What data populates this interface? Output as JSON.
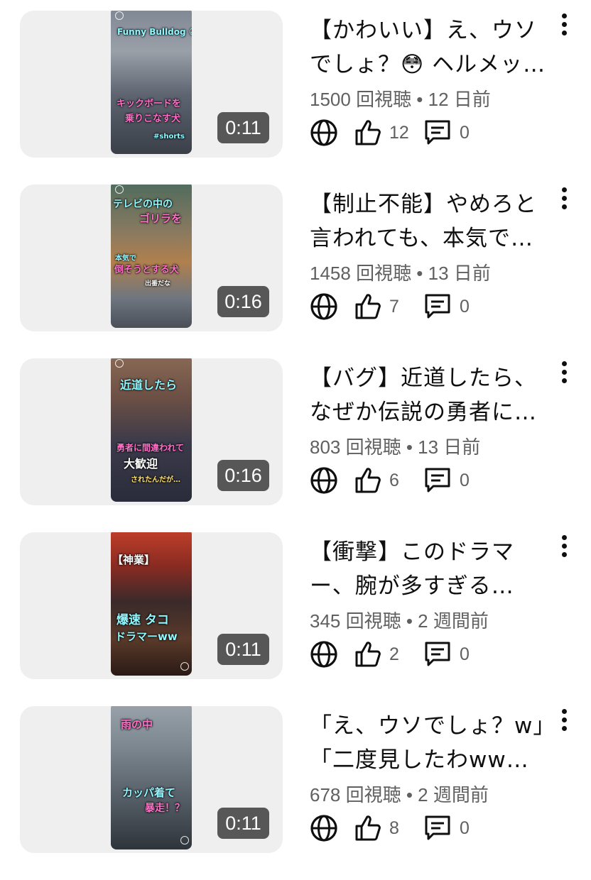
{
  "videos": [
    {
      "title": "【かわいい】え、ウソでしょ？😳 ヘルメッ…",
      "meta": "1500 回視聴 • 12 日前",
      "likes": "12",
      "comments": "0",
      "duration": "0:11",
      "overlay": {
        "t1": "Funny Bulldog 😆",
        "t2": "キックボードを",
        "t3": "乗りこなす犬",
        "t4": "#shorts"
      }
    },
    {
      "title": "【制止不能】やめろと言われても、本気で…",
      "meta": "1458 回視聴 • 13 日前",
      "likes": "7",
      "comments": "0",
      "duration": "0:16",
      "overlay": {
        "t1": "テレビの中の",
        "t2": "ゴリラを",
        "t3": "本気で",
        "t4": "倒そうとする犬",
        "t5": "出番だな"
      }
    },
    {
      "title": "【バグ】近道したら、なぜか伝説の勇者に…",
      "meta": "803 回視聴 • 13 日前",
      "likes": "6",
      "comments": "0",
      "duration": "0:16",
      "overlay": {
        "t1": "近道したら",
        "t2": "勇者に間違われて",
        "t3": "大歓迎",
        "t4": "されたんだが…"
      }
    },
    {
      "title": "【衝撃】このドラマー、腕が多すぎる…",
      "meta": "345 回視聴 • 2 週間前",
      "likes": "2",
      "comments": "0",
      "duration": "0:11",
      "overlay": {
        "t1": "【神業】",
        "t2": "爆速 タコ",
        "t3": "ドラマーww"
      }
    },
    {
      "title": "「え、ウソでしょ？w」「二度見したわww…",
      "meta": "678 回視聴 • 2 週間前",
      "likes": "8",
      "comments": "0",
      "duration": "0:11",
      "overlay": {
        "t1": "雨の中",
        "t2": "カッパ着て",
        "t3": "暴走！？"
      }
    }
  ],
  "icons": {
    "visibility": "globe-icon",
    "like": "thumbs-up-icon",
    "comment": "comment-icon",
    "menu": "more-vert-icon"
  },
  "colors": {
    "text": "#0f0f0f",
    "secondary": "#606060",
    "card": "#efefef"
  }
}
